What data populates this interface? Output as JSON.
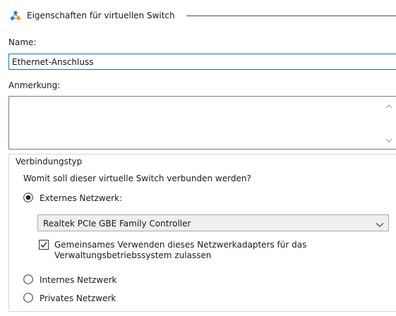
{
  "section": {
    "title": "Eigenschaften für virtuellen Switch",
    "icon": "network-switch-icon"
  },
  "name_field": {
    "label": "Name:",
    "value": "Ethernet-Anschluss"
  },
  "notes_field": {
    "label": "Anmerkung:",
    "value": ""
  },
  "connection": {
    "legend": "Verbindungstyp",
    "question": "Womit soll dieser virtuelle Switch verbunden werden?",
    "options": [
      {
        "label": "Externes Netzwerk:",
        "selected": true
      },
      {
        "label": "Internes Netzwerk",
        "selected": false
      },
      {
        "label": "Privates Netzwerk",
        "selected": false
      }
    ],
    "adapter_select": {
      "value": "Realtek PCIe GBE Family Controller"
    },
    "share_checkbox": {
      "label": "Gemeinsames Verwenden dieses Netzwerkadapters für das Verwaltungsbetriebssystem zulassen",
      "checked": true
    }
  },
  "colors": {
    "focus_border": "#0078d7",
    "text": "#1a1a1a"
  }
}
